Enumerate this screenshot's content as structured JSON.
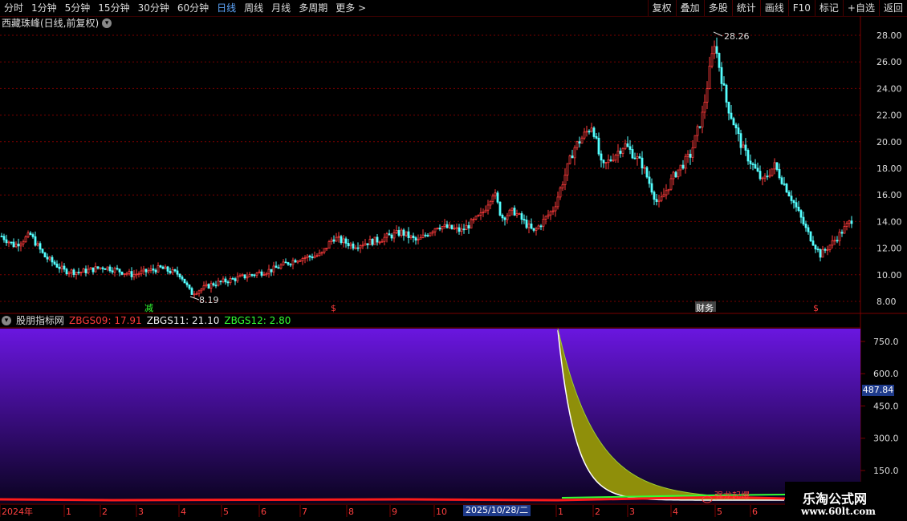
{
  "toolbar": {
    "tabs": [
      "分时",
      "1分钟",
      "5分钟",
      "15分钟",
      "30分钟",
      "60分钟",
      "日线",
      "周线",
      "月线",
      "多周期",
      "更多 >"
    ],
    "active_tab": "日线",
    "buttons": [
      "复权",
      "叠加",
      "多股",
      "统计",
      "画线",
      "F10",
      "标记",
      "+自选",
      "返回"
    ]
  },
  "stock_title": "西藏珠峰(日线,前复权)",
  "price_axis": [
    "28.00",
    "26.00",
    "24.00",
    "22.00",
    "20.00",
    "18.00",
    "16.00",
    "14.00",
    "12.00",
    "10.00",
    "8.00"
  ],
  "markers": {
    "high": "28.26",
    "low": "8.19",
    "events": [
      "减",
      "$",
      "财务",
      "$"
    ]
  },
  "indicator": {
    "name": "股朋指标网",
    "zbgs09_label": "ZBGS09:",
    "zbgs09_value": "17.91",
    "zbgs11_label": "ZBGS11:",
    "zbgs11_value": "21.10",
    "zbgs12_label": "ZBGS12:",
    "zbgs12_value": "2.80",
    "axis": [
      "750.0",
      "600.0",
      "450.0",
      "300.0",
      "150.0"
    ],
    "current_value": "487.84",
    "note": "强龙起爆"
  },
  "date_axis": [
    "2024年",
    "1",
    "2",
    "3",
    "4",
    "5",
    "6",
    "7",
    "8",
    "9",
    "10",
    "1",
    "2",
    "3",
    "4",
    "5",
    "6"
  ],
  "selected_date": "2025/10/28/二",
  "watermark": {
    "title": "乐淘公式网",
    "url": "www.60lt.com"
  },
  "colors": {
    "up": "#ff3b3b",
    "down": "#54ffff",
    "panel_purple": "#5a12c8",
    "accent_blue": "#5fa8ff"
  }
}
